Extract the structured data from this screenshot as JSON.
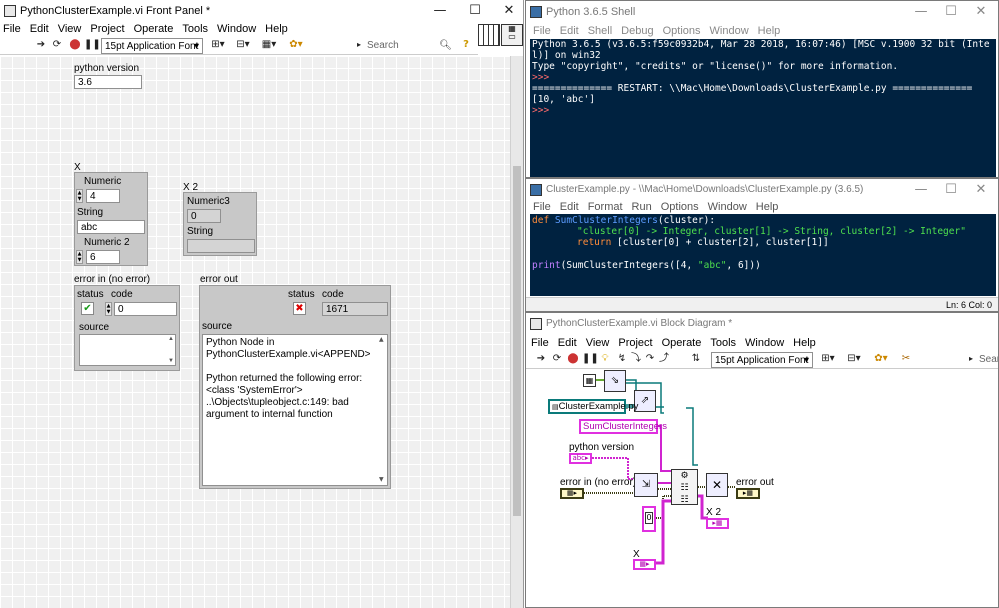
{
  "fp": {
    "title": "PythonClusterExample.vi Front Panel *",
    "menu": [
      "File",
      "Edit",
      "View",
      "Project",
      "Operate",
      "Tools",
      "Window",
      "Help"
    ],
    "font": "15pt Application Font",
    "search": "Search",
    "pyver_label": "python version",
    "pyver": "3.6",
    "x_label": "X",
    "num_label": "Numeric",
    "num_val": "4",
    "str_label": "String",
    "str_val": "abc",
    "num2_label": "Numeric 2",
    "num2_val": "6",
    "x2_label": "X 2",
    "num3_label": "Numeric3",
    "num3_val": "0",
    "str2_label": "String",
    "ein_label": "error in (no error)",
    "status": "status",
    "code": "code",
    "ein_code": "0",
    "source": "source",
    "eout_label": "error out",
    "eout_code": "1671",
    "eout_source": "Python Node in PythonClusterExample.vi<APPEND>\n\nPython returned the following error: <class 'SystemError'>\n..\\Objects\\tupleobject.c:149: bad argument to internal function"
  },
  "shell": {
    "title": "Python 3.6.5 Shell",
    "menu": [
      "File",
      "Edit",
      "Shell",
      "Debug",
      "Options",
      "Window",
      "Help"
    ],
    "lines": [
      "Python 3.6.5 (v3.6.5:f59c0932b4, Mar 28 2018, 16:07:46) [MSC v.1900 32 bit (Inte",
      "l)] on win32",
      "Type \"copyright\", \"credits\" or \"license()\" for more information.",
      ">>> ",
      "============== RESTART: \\\\Mac\\Home\\Downloads\\ClusterExample.py ==============",
      "[10, 'abc']",
      ">>> "
    ]
  },
  "editor": {
    "title": "ClusterExample.py - \\\\Mac\\Home\\Downloads\\ClusterExample.py (3.6.5)",
    "menu": [
      "File",
      "Edit",
      "Format",
      "Run",
      "Options",
      "Window",
      "Help"
    ],
    "kw_def": "def ",
    "fn": "SumClusterIntegers",
    "sig": "(cluster):",
    "doc": "\"cluster[0] -> Integer, cluster[1] -> String, cluster[2] -> Integer\"",
    "kw_return": "return",
    "ret": " [cluster[0] + cluster[2], cluster[1]]",
    "kw_print": "print",
    "call": "(SumClusterIntegers([4, ",
    "str": "\"abc\"",
    "call_end": ", 6]))",
    "status": "Ln: 6   Col: 0"
  },
  "bd": {
    "title": "PythonClusterExample.vi Block Diagram *",
    "menu": [
      "File",
      "Edit",
      "View",
      "Project",
      "Operate",
      "Tools",
      "Window",
      "Help"
    ],
    "font": "15pt Application Font",
    "search": "Searc",
    "path": "ClusterExample.py",
    "func": "SumClusterIntegers",
    "pyver": "python version",
    "ein": "error in (no error)",
    "eout": "error out",
    "x2": "X 2",
    "x": "X",
    "zero": "0"
  }
}
